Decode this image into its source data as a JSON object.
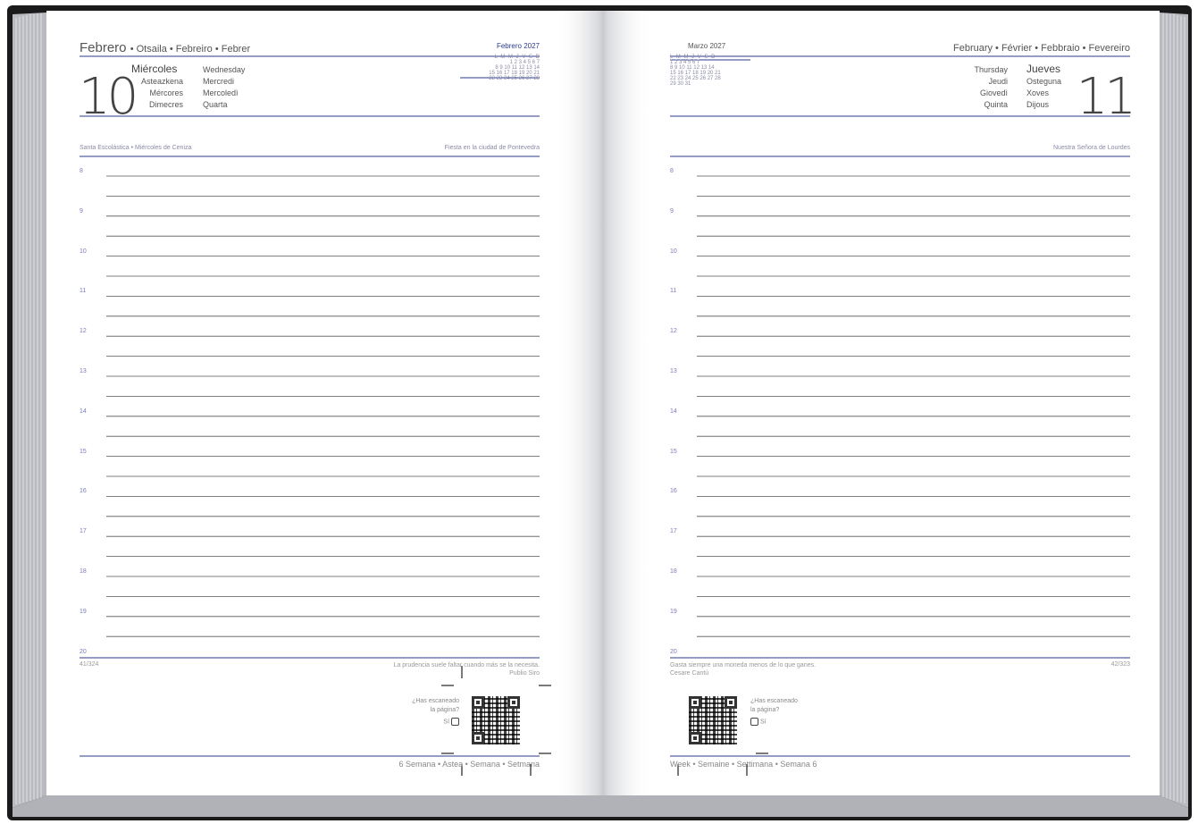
{
  "left": {
    "month": "Febrero",
    "month_langs": "• Otsaila • Febreiro • Febrer",
    "day_number": "10",
    "day_name": "Miércoles",
    "lang_left": [
      "Asteazkena",
      "Mércores",
      "Dimecres"
    ],
    "lang_right": [
      "Wednesday",
      "Mercredi",
      "Mercoledì",
      "Quarta"
    ],
    "mini_cal_title": "Febrero 2027",
    "mini_cal_header": "L M M J V S D",
    "mini_cal_rows": [
      "1  2  3  4  5  6  7",
      "8  9 10 11 12 13 14",
      "15 16 17 18 19 20 21",
      "22 23 24 25 26 27 28"
    ],
    "feast_left": "Santa Escolástica • Miércoles de Ceniza",
    "feast_right": "Fiesta en la ciudad de Pontevedra",
    "page_count": "41/324",
    "quote": "La prudencia suele faltar cuando más se la necesita.",
    "quote_author": "Publio Siro",
    "scan_q1": "¿Has escaneado",
    "scan_q2": "la página?",
    "scan_yes": "Sí",
    "week": "6 Semana • Astea • Semana • Setmana"
  },
  "right": {
    "mini_cal_title": "Marzo 2027",
    "mini_cal_header": "L M M J V S D",
    "mini_cal_rows": [
      "1  2  3  4  5  6  7",
      "8  9 10 11 12 13 14",
      "15 16 17 18 19 20 21",
      "22 23 24 25 26 27 28",
      "29 30 31"
    ],
    "month_langs": "February • Février • Febbraio • Fevereiro",
    "day_number": "11",
    "day_name": "Jueves",
    "lang_left": [
      "Thursday",
      "Jeudi",
      "Giovedì",
      "Quinta"
    ],
    "lang_right": [
      "Osteguna",
      "Xoves",
      "Dijous"
    ],
    "feast_right": "Nuestra Señora de Lourdes",
    "page_count": "42/323",
    "quote": "Gasta siempre una moneda menos de lo que ganes.",
    "quote_author": "Cesare Cantú",
    "scan_q1": "¿Has escaneado",
    "scan_q2": "la página?",
    "scan_yes": "Sí",
    "week": "Week • Semaine • Settimana • Semana 6"
  },
  "hours": [
    "8",
    "9",
    "10",
    "11",
    "12",
    "13",
    "14",
    "15",
    "16",
    "17",
    "18",
    "19",
    "20"
  ],
  "colors": {
    "accent": "#2b3a8c",
    "cover": "#1a1a1a",
    "page_edge": "#c8cad0"
  }
}
